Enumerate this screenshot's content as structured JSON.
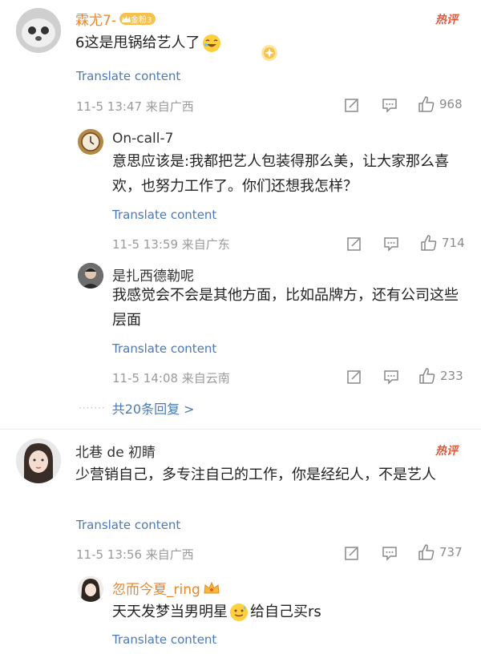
{
  "comments": [
    {
      "user": "霖尤7-",
      "badge": "金粉3",
      "hot_label": "热评",
      "text": "6这是甩锅给艺人了",
      "translate": "Translate content",
      "time": "11-5 13:47 来自广西",
      "likes": "968",
      "replies": [
        {
          "user": "On-call-7",
          "text": "意思应该是:我都把艺人包装得那么美，让大家那么喜欢，也努力工作了。你们还想我怎样？",
          "translate": "Translate content",
          "time": "11-5 13:59 来自广东",
          "likes": "714"
        },
        {
          "user": "是扎西德勒呢",
          "text": "我感觉会不会是其他方面，比如品牌方，还有公司这些层面",
          "translate": "Translate content",
          "time": "11-5 14:08 来自云南",
          "likes": "233"
        }
      ],
      "more_replies": "共20条回复 >"
    },
    {
      "user": "北巷 de 初睛",
      "hot_label": "热评",
      "text": "少营销自己，多专注自己的工作，你是经纪人，不是艺人",
      "translate": "Translate content",
      "time": "11-5 13:56 来自广西",
      "likes": "737",
      "replies": [
        {
          "user": "忽而今夏_ring",
          "text_before": "天天发梦当男明星",
          "text_after": "给自己买rs",
          "translate": "Translate content"
        }
      ]
    }
  ],
  "colors": {
    "accent_orange": "#e8882b",
    "link_blue": "#4c79b5",
    "hot_red": "#e25a3c"
  },
  "icons": [
    "edit-icon",
    "comment-icon",
    "like-icon",
    "crown-icon",
    "laugh-emoji",
    "sweat-emoji",
    "sparkle-sticker"
  ]
}
